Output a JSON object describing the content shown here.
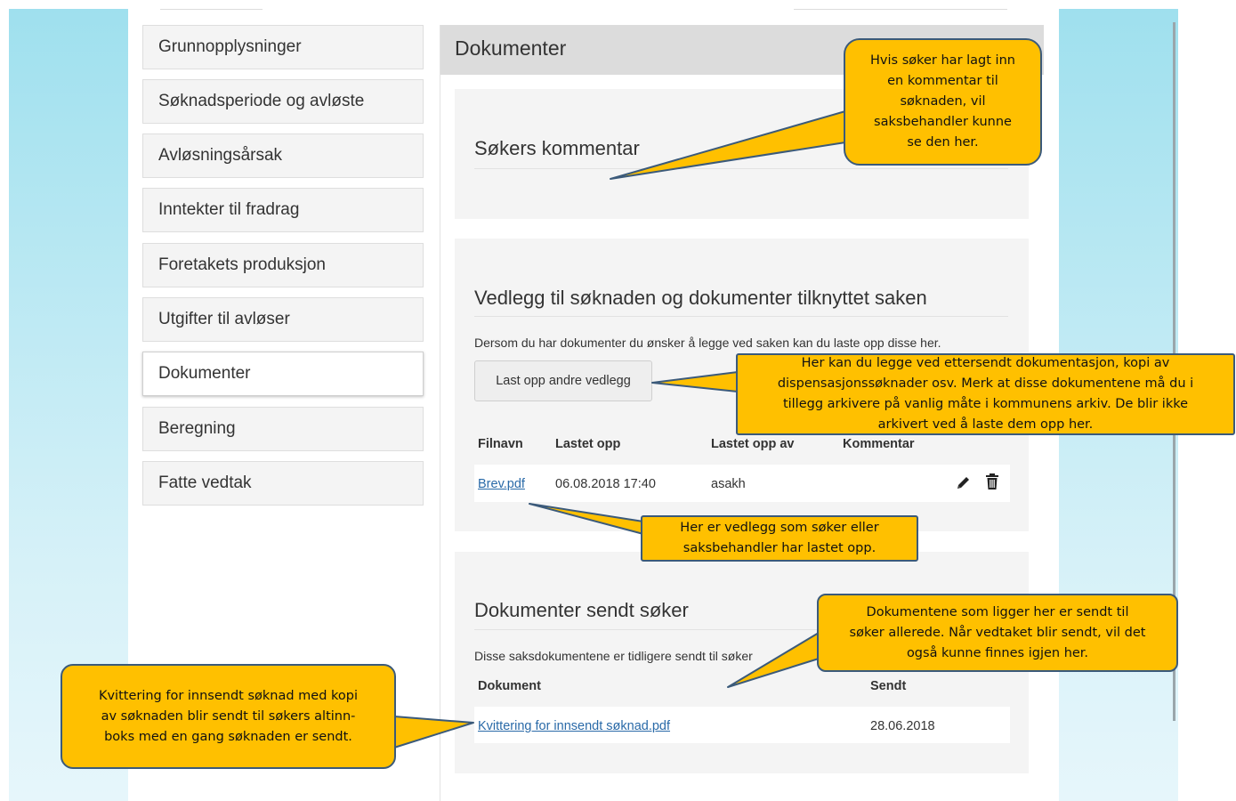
{
  "sidebar": {
    "items": [
      {
        "label": "Grunnopplysninger"
      },
      {
        "label": "Søknadsperiode og avløste"
      },
      {
        "label": "Avløsningsårsak"
      },
      {
        "label": "Inntekter til fradrag"
      },
      {
        "label": "Foretakets produksjon"
      },
      {
        "label": "Utgifter til avløser"
      },
      {
        "label": "Dokumenter",
        "active": true
      },
      {
        "label": "Beregning"
      },
      {
        "label": "Fatte vedtak"
      }
    ]
  },
  "header": {
    "title": "Dokumenter"
  },
  "comment_panel": {
    "title": "Søkers kommentar"
  },
  "attachments_panel": {
    "title": "Vedlegg til søknaden og dokumenter tilknyttet saken",
    "description": "Dersom du har dokumenter du ønsker å legge ved saken kan du laste opp disse her.",
    "upload_button": "Last opp andre vedlegg",
    "columns": {
      "filename": "Filnavn",
      "uploaded": "Lastet opp",
      "uploaded_by": "Lastet opp av",
      "comment": "Kommentar"
    },
    "rows": [
      {
        "filename": "Brev.pdf",
        "uploaded": "06.08.2018 17:40",
        "uploaded_by": "asakh",
        "comment": ""
      }
    ],
    "icons": {
      "edit": "pencil-icon",
      "delete": "trash-icon"
    }
  },
  "sent_panel": {
    "title": "Dokumenter sendt søker",
    "description": "Disse saksdokumentene er tidligere sendt til søker",
    "columns": {
      "document": "Dokument",
      "sent": "Sendt"
    },
    "rows": [
      {
        "document": "Kvittering for innsendt søknad.pdf",
        "sent": "28.06.2018"
      }
    ]
  },
  "callouts": {
    "comment": [
      "Hvis søker har lagt inn",
      "en kommentar til",
      "søknaden, vil",
      "saksbehandler kunne",
      "se den her."
    ],
    "upload": [
      "Her kan du legge ved ettersendt  dokumentasjon, kopi av",
      "dispensasjonssøknader osv. Merk at disse dokumentene må du i",
      "tillegg arkivere på vanlig måte i kommunens arkiv. De blir ikke",
      "arkivert ved å laste dem opp her."
    ],
    "attachments": [
      "Her er vedlegg som søker eller",
      "saksbehandler har lastet opp."
    ],
    "sent": [
      "Dokumentene som ligger her er sendt til",
      "søker allerede.  Når vedtaket blir sendt, vil det",
      "også kunne finnes igjen her."
    ],
    "receipt": [
      "Kvittering for innsendt søknad med kopi",
      "av søknaden blir sendt til søkers altinn-",
      "boks med en gang søknaden er sendt."
    ]
  },
  "colors": {
    "callout_fill": "#ffc000",
    "callout_border": "#3b5a7a",
    "link": "#2a6aa8",
    "background_gradient": "#9fe0ee"
  }
}
